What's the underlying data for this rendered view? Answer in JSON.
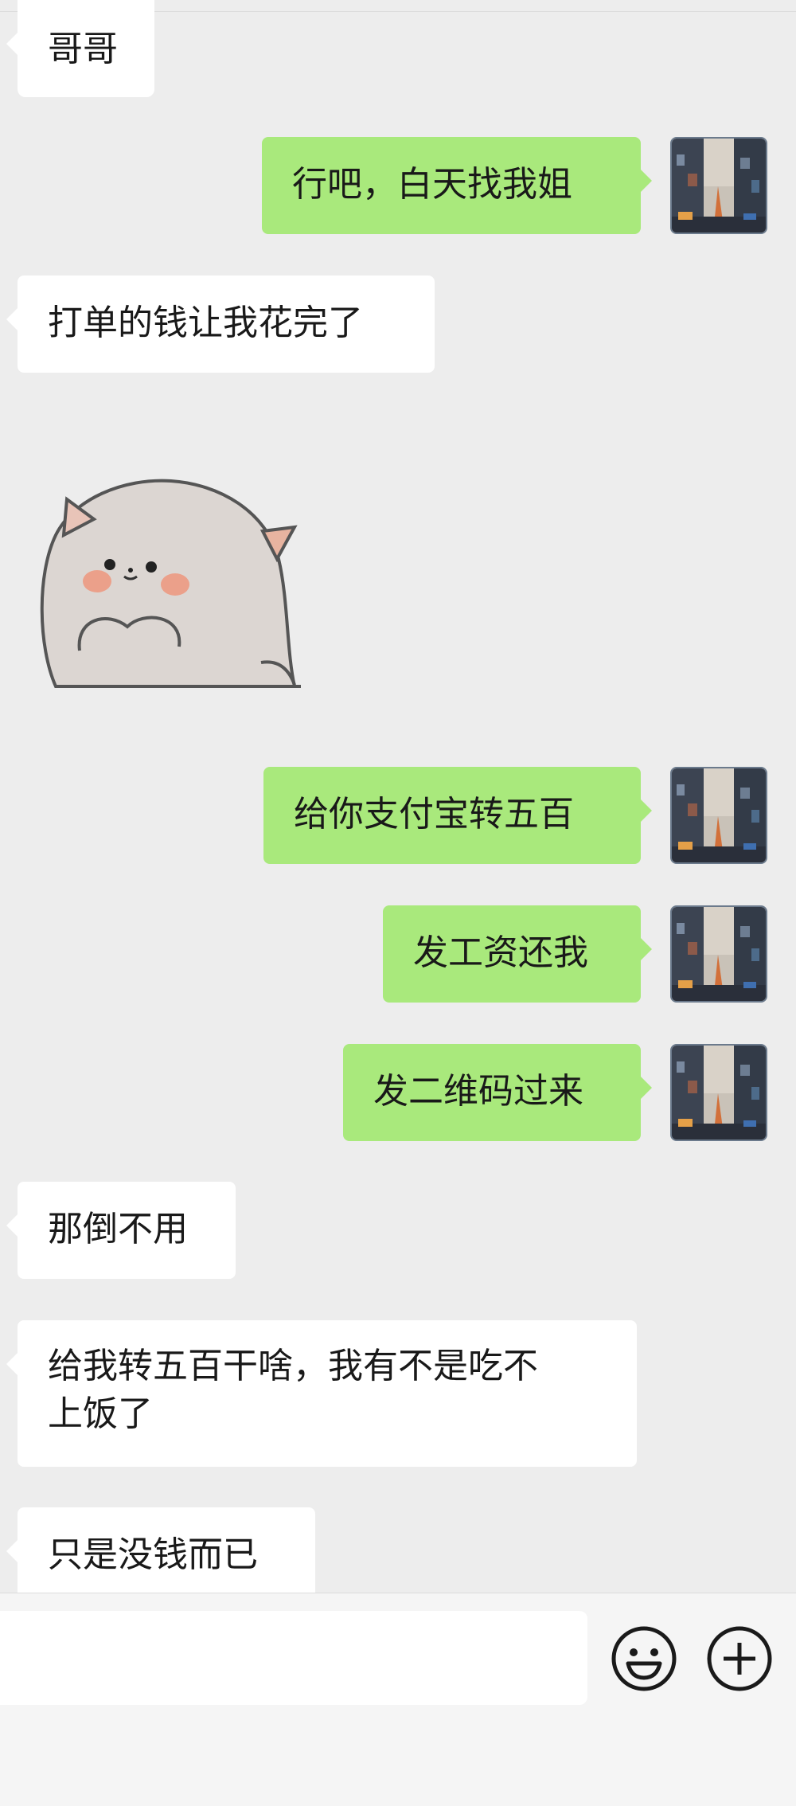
{
  "messages": [
    {
      "side": "in",
      "text": "哥哥"
    },
    {
      "side": "out",
      "text": "行吧，白天找我姐"
    },
    {
      "side": "in",
      "text": "打单的钱让我花完了"
    },
    {
      "side": "in",
      "type": "sticker",
      "sticker": "chubby-cat-clasping-paws"
    },
    {
      "side": "out",
      "text": "给你支付宝转五百"
    },
    {
      "side": "out",
      "text": "发工资还我"
    },
    {
      "side": "out",
      "text": "发二维码过来"
    },
    {
      "side": "in",
      "text": "那倒不用"
    },
    {
      "side": "in",
      "text_line1": "给我转五百干啥，我有不是吃不",
      "text_line2": "上饭了"
    },
    {
      "side": "in",
      "text": "只是没钱而已"
    }
  ],
  "input_bar": {
    "placeholder": "",
    "emoji_icon": "smiley-face-icon",
    "plus_icon": "plus-circle-icon"
  },
  "colors": {
    "background": "#ededed",
    "incoming_bubble": "#ffffff",
    "outgoing_bubble": "#a9e97c",
    "text": "#191919"
  }
}
